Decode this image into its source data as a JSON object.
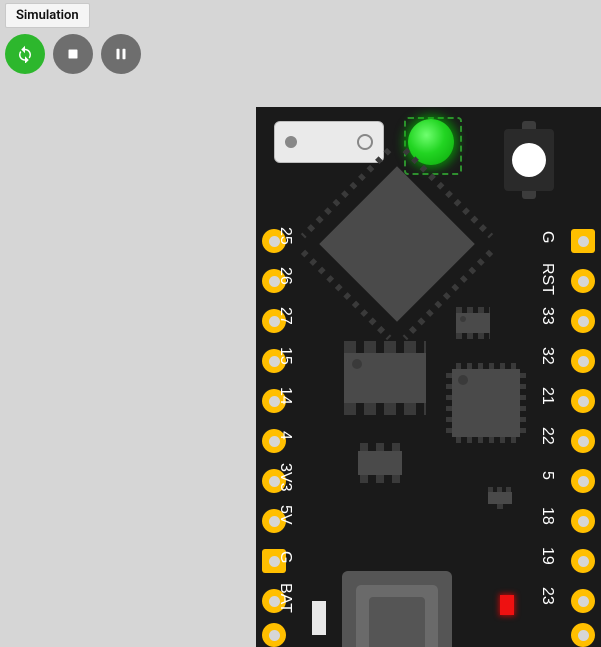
{
  "tab": {
    "label": "Simulation"
  },
  "controls": {
    "run": {
      "name": "restart-button"
    },
    "stop": {
      "name": "stop-button"
    },
    "pause": {
      "name": "pause-button"
    }
  },
  "board": {
    "name": "esp32-dev-board",
    "left_pins": [
      "25",
      "26",
      "27",
      "15",
      "14",
      "4",
      "3V3",
      "5V",
      "G",
      "BAT"
    ],
    "right_pins": [
      "G",
      "RST",
      "33",
      "32",
      "21",
      "22",
      "5",
      "18",
      "19",
      "23"
    ],
    "status_led": {
      "color": "#22d522",
      "on": true
    },
    "power_led": {
      "color": "#e11",
      "on": true
    }
  }
}
